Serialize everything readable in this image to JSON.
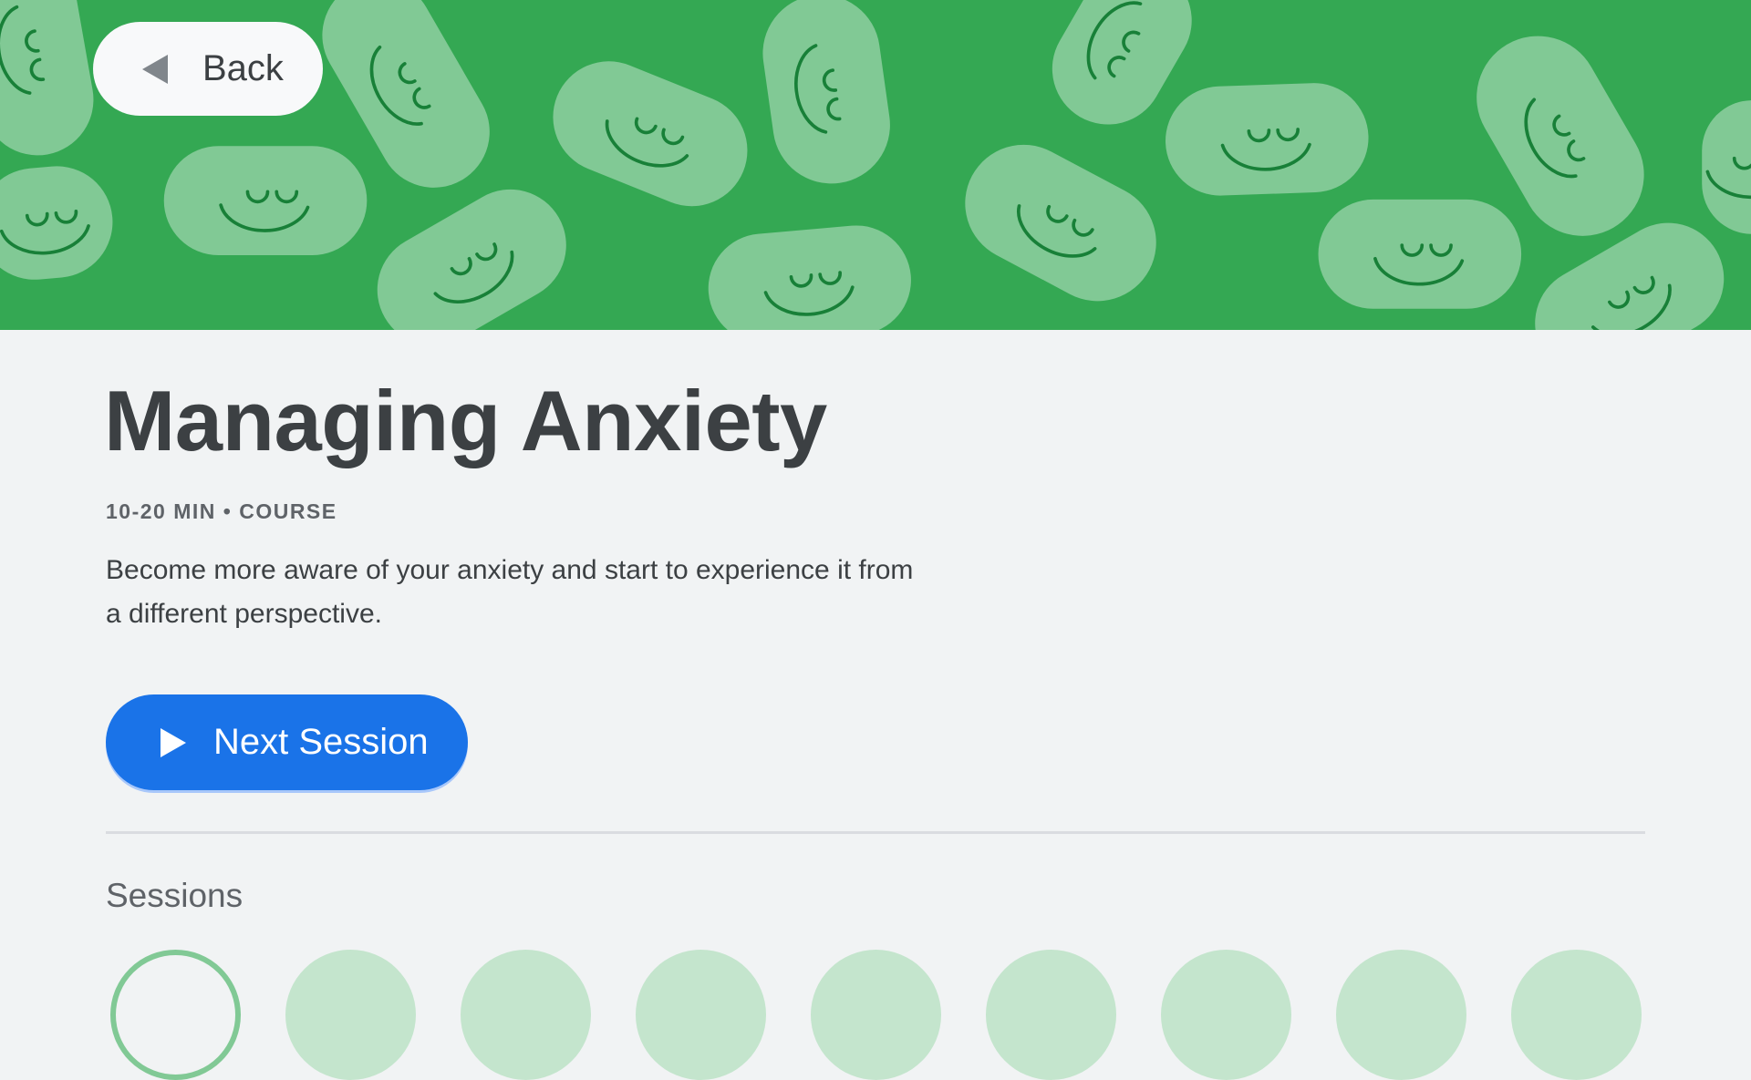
{
  "header": {
    "back_label": "Back",
    "back_icon": "triangle-left-icon",
    "banner_color": "#34a853",
    "pattern_color": "#81c995"
  },
  "course": {
    "title": "Managing Anxiety",
    "meta": "10-20 MIN • COURSE",
    "description": "Become more aware of your anxiety and start to experience it from a different perspective.",
    "next_session_label": "Next Session",
    "next_session_icon": "play-icon",
    "accent_color": "#1a73e8"
  },
  "sessions": {
    "heading": "Sessions",
    "items": [
      {
        "state": "current"
      },
      {
        "state": "locked"
      },
      {
        "state": "locked"
      },
      {
        "state": "locked"
      },
      {
        "state": "locked"
      },
      {
        "state": "locked"
      },
      {
        "state": "locked"
      },
      {
        "state": "locked"
      },
      {
        "state": "locked"
      }
    ]
  }
}
